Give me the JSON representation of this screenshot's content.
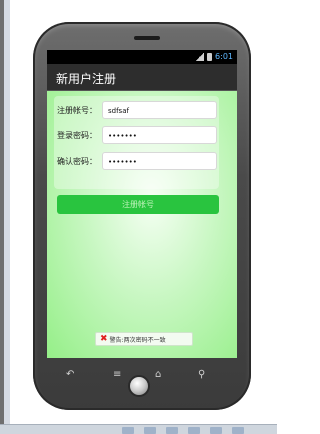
{
  "status": {
    "time": "6:01"
  },
  "app": {
    "title": "新用户注册"
  },
  "form": {
    "account": {
      "label": "注册帐号：",
      "value": "sdfsaf"
    },
    "password": {
      "label": "登录密码：",
      "value": "•••••••"
    },
    "confirm": {
      "label": "确认密码：",
      "value": "•••••••"
    }
  },
  "register_button": {
    "label": "注册帐号"
  },
  "toast": {
    "message": "警告:两次密码不一致"
  },
  "nav": {
    "back": "↶",
    "menu": "≡",
    "home": "⌂",
    "search": "⚲"
  }
}
